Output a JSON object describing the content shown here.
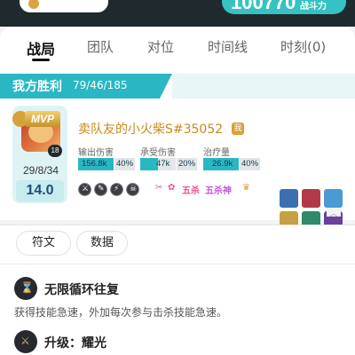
{
  "banner": {
    "score_text": "100770",
    "score_suffix": "战斗力"
  },
  "tabs": [
    {
      "label": "战局",
      "active": true
    },
    {
      "label": "团队",
      "active": false
    },
    {
      "label": "对位",
      "active": false
    },
    {
      "label": "时间线",
      "active": false
    },
    {
      "label": "时刻(0)",
      "active": false
    }
  ],
  "result": {
    "label": "我方胜利",
    "team_kda": "79/46/185"
  },
  "player": {
    "badge": "MVP",
    "level": "18",
    "kda": "29/8/34",
    "score": "14.0",
    "name": "卖队友的小火柴S#35052",
    "me_tag": "我",
    "stats": [
      {
        "label": "输出伤害",
        "value": "156.8k",
        "percent": "40%",
        "fill": 0.4
      },
      {
        "label": "承受伤害",
        "value": "47k",
        "percent": "20%",
        "fill": 0.2
      },
      {
        "label": "治疗量",
        "value": "26.9k",
        "percent": "40%",
        "fill": 0.4
      }
    ],
    "item_icons": [
      "sword-icon",
      "knife-icon",
      "wand-icon",
      "skull-icon"
    ],
    "honors": [
      "double-kill-icon",
      "triple-kill-icon",
      "五杀",
      "penta-icon",
      "crown-icon"
    ],
    "honor_text": "五杀神",
    "equipment_colors": [
      "#3b6fb0",
      "#b23a48",
      "#4a9ad6",
      "#c6a043",
      "#2e8a6a",
      "#6b3fa0"
    ]
  },
  "subtabs": [
    {
      "label": "符文",
      "active": true
    },
    {
      "label": "数据",
      "active": false
    }
  ],
  "runes": [
    {
      "name": "无限循环往复",
      "icon": "hourglass-icon",
      "desc": "获得技能急速，外加每次参与击杀技能急速。"
    },
    {
      "name": "升级：耀光",
      "icon": "sword-icon"
    }
  ]
}
